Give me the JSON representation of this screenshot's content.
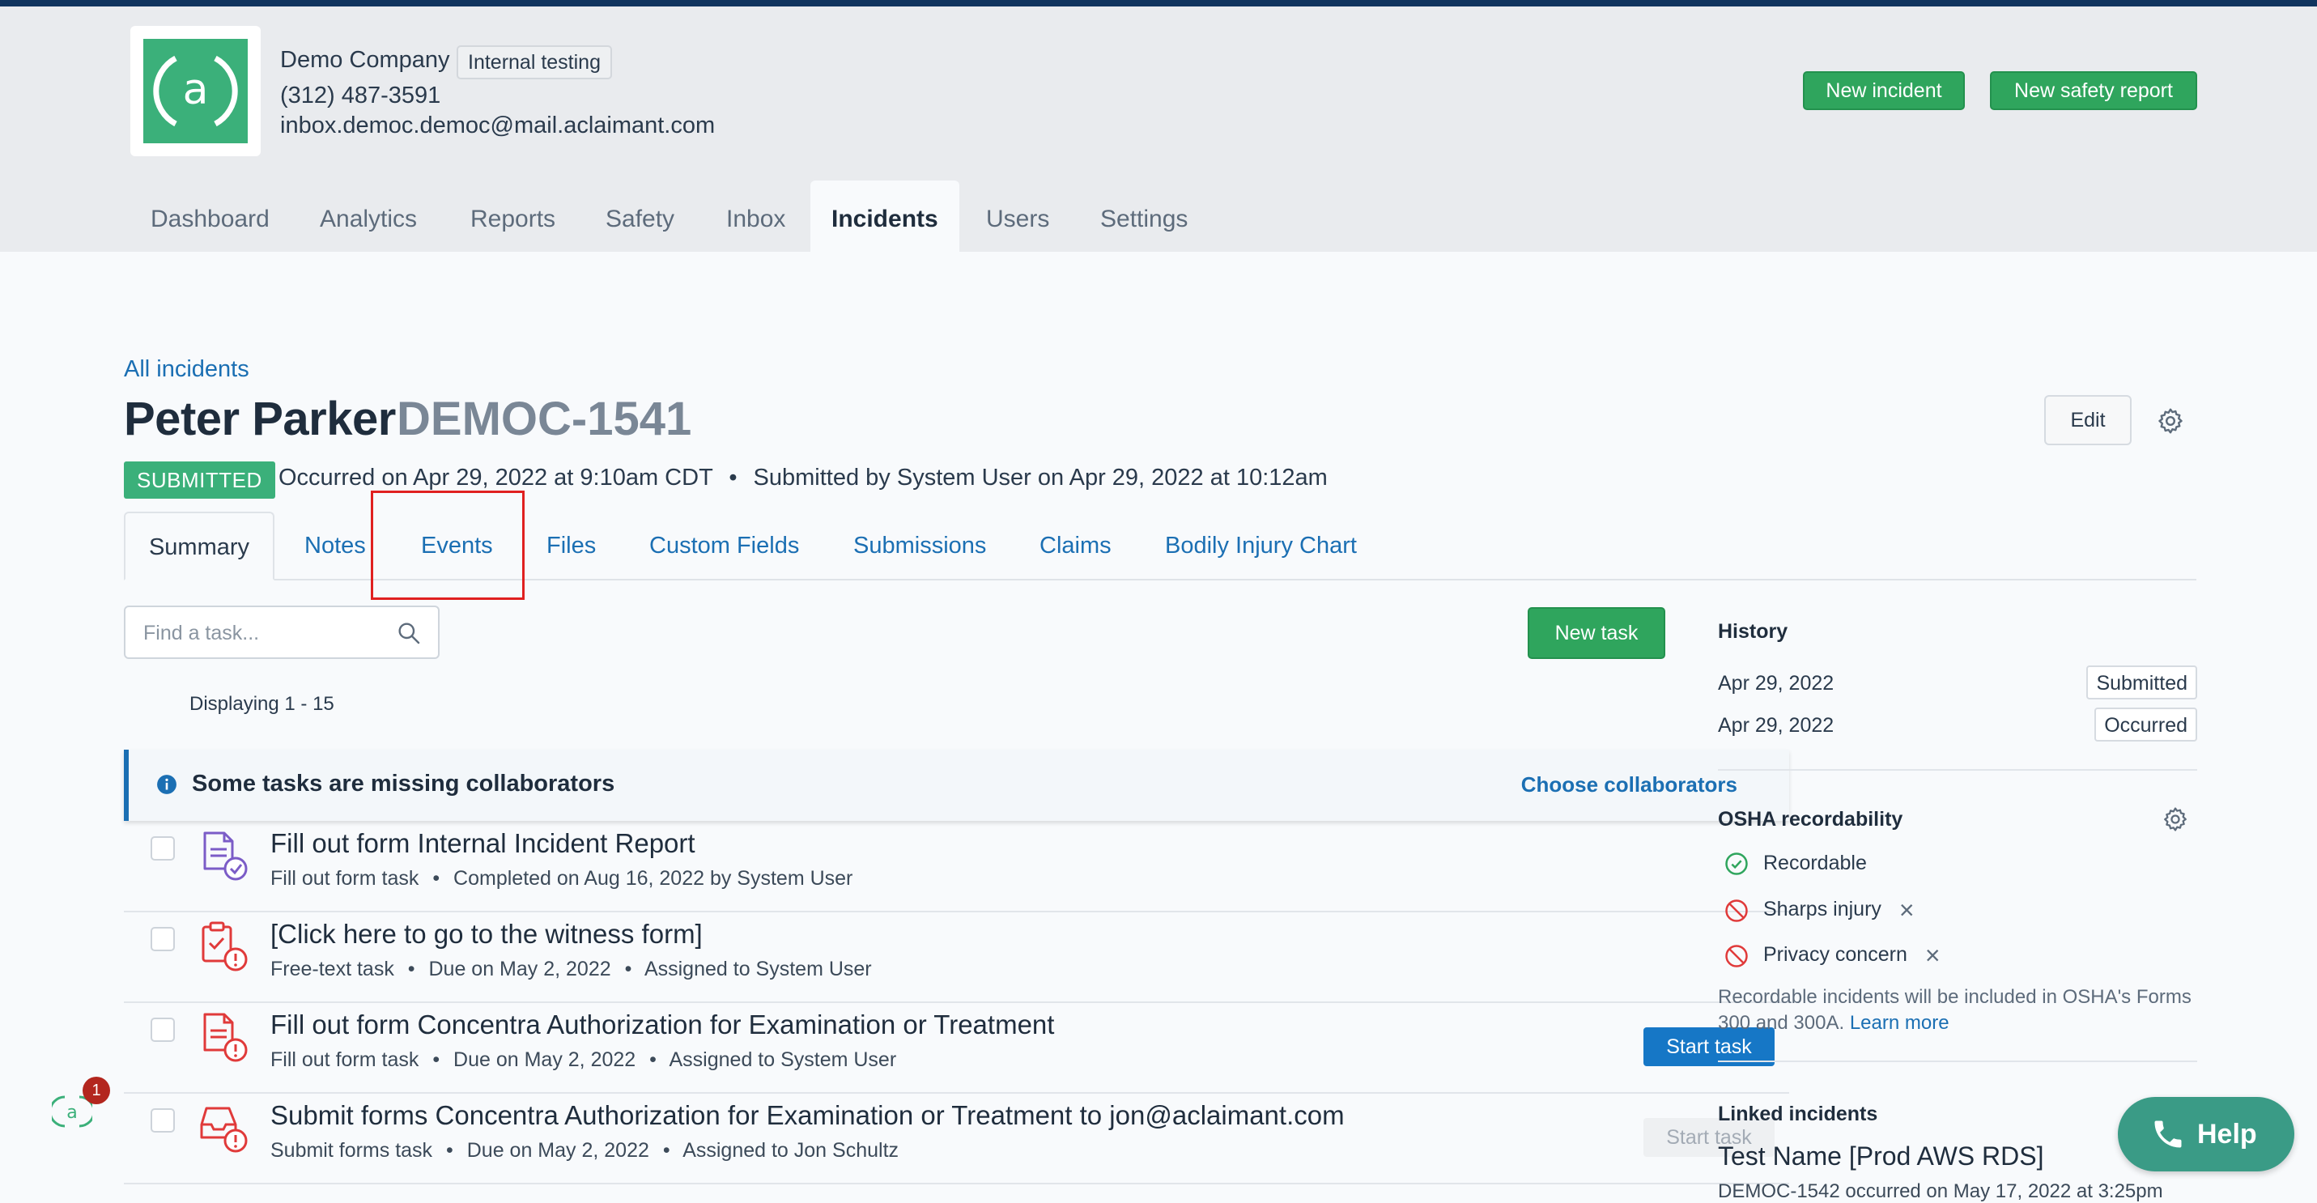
{
  "company": {
    "name": "Demo Company",
    "env_badge": "Internal testing",
    "phone": "(312) 487-3591",
    "email": "inbox.democ.democ@mail.aclaimant.com",
    "logo_letter": "a"
  },
  "header_actions": {
    "new_incident": "New incident",
    "new_safety_report": "New safety report"
  },
  "nav": {
    "items": [
      "Dashboard",
      "Analytics",
      "Reports",
      "Safety",
      "Inbox",
      "Incidents",
      "Users",
      "Settings"
    ],
    "active": "Incidents"
  },
  "breadcrumb": "All incidents",
  "incident": {
    "name": "Peter Parker",
    "id": "DEMOC-1541",
    "status": "SUBMITTED",
    "occurred": "Occurred on Apr 29, 2022 at 9:10am CDT",
    "submitted": "Submitted by System User on Apr 29, 2022 at 10:12am",
    "edit_label": "Edit"
  },
  "tabs": [
    "Summary",
    "Notes",
    "Events",
    "Files",
    "Custom Fields",
    "Submissions",
    "Claims",
    "Bodily Injury Chart"
  ],
  "tasks_panel": {
    "search_placeholder": "Find a task...",
    "new_task_label": "New task",
    "displaying": "Displaying 1 - 15",
    "alert_text": "Some tasks are missing collaborators",
    "alert_link": "Choose collaborators"
  },
  "tasks": [
    {
      "title": "Fill out form Internal Incident Report",
      "type": "Fill out form task",
      "detail1": "Completed on Aug 16, 2022 by System User",
      "detail2": "",
      "icon": "form-completed-icon",
      "action": ""
    },
    {
      "title": "[Click here to go to the witness form]",
      "type": "Free-text task",
      "detail1": "Due on May 2, 2022",
      "detail2": "Assigned to System User",
      "icon": "clipboard-warning-icon",
      "action": ""
    },
    {
      "title": "Fill out form Concentra Authorization for Examination or Treatment",
      "type": "Fill out form task",
      "detail1": "Due on May 2, 2022",
      "detail2": "Assigned to System User",
      "icon": "form-warning-icon",
      "action": "Start task"
    },
    {
      "title": "Submit forms Concentra Authorization for Examination or Treatment to jon@aclaimant.com",
      "type": "Submit forms task",
      "detail1": "Due on May 2, 2022",
      "detail2": "Assigned to Jon Schultz",
      "icon": "inbox-warning-icon",
      "action": "Start task"
    }
  ],
  "history": {
    "title": "History",
    "entries": [
      {
        "date": "Apr 29, 2022",
        "label": "Submitted"
      },
      {
        "date": "Apr 29, 2022",
        "label": "Occurred"
      }
    ]
  },
  "osha": {
    "title": "OSHA recordability",
    "items": [
      {
        "label": "Recordable",
        "state": "yes"
      },
      {
        "label": "Sharps injury",
        "state": "no"
      },
      {
        "label": "Privacy concern",
        "state": "no"
      }
    ],
    "note": "Recordable incidents will be included in OSHA's Forms 300 and 300A.",
    "learn_more": "Learn more"
  },
  "linked": {
    "title": "Linked incidents",
    "item_title": "Test Name [Prod AWS RDS]",
    "item_sub": "DEMOC-1542 occurred on May 17, 2022 at 3:25pm"
  },
  "help_label": "Help",
  "notification_count": "1",
  "colors": {
    "brand_green": "#3bb07a",
    "link_blue": "#1b6fb3",
    "primary_blue": "#1677c6",
    "warning_red": "#e03a3a",
    "header_bg": "#e9ebee",
    "top_strip": "#10345e"
  }
}
